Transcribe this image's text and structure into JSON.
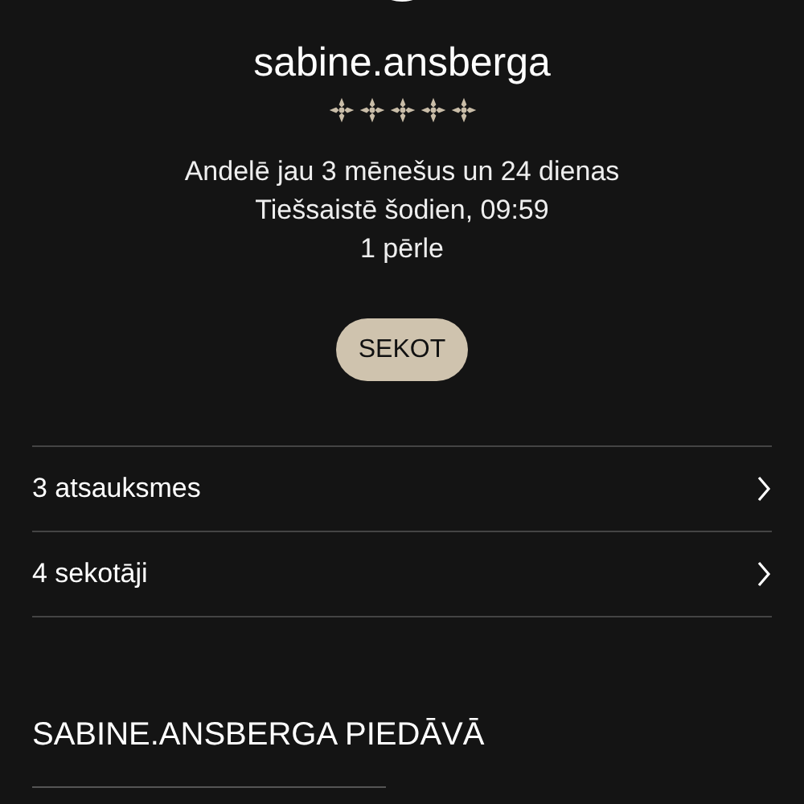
{
  "profile": {
    "username": "sabine.ansberga",
    "stars": 5,
    "details": [
      "Andelē jau 3 mēnešus un 24 dienas",
      "Tiešsaistē šodien, 09:59",
      "1 pērle"
    ]
  },
  "follow_button": {
    "label": "SEKOT"
  },
  "links": [
    {
      "label": "3 atsauksmes"
    },
    {
      "label": "4 sekotāji"
    }
  ],
  "section": {
    "title": "SABINE.ANSBERGA PIEDĀVĀ"
  }
}
